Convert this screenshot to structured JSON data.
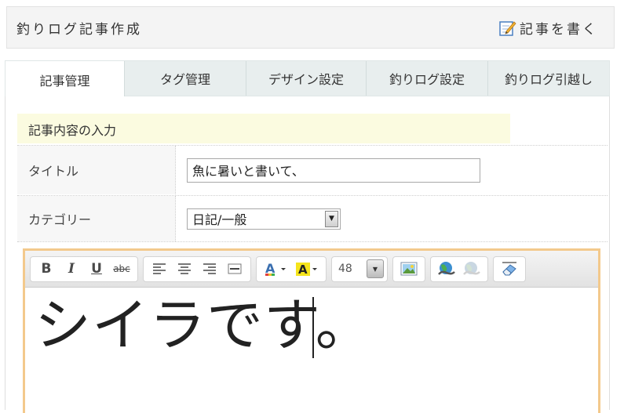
{
  "header": {
    "title": "釣りログ記事作成",
    "write_link": "記事を書く",
    "write_icon": "pencil-note-icon"
  },
  "tabs": [
    {
      "label": "記事管理",
      "active": true
    },
    {
      "label": "タグ管理",
      "active": false
    },
    {
      "label": "デザイン設定",
      "active": false
    },
    {
      "label": "釣りログ設定",
      "active": false
    },
    {
      "label": "釣りログ引越し",
      "active": false
    }
  ],
  "form": {
    "section_label": "記事内容の入力",
    "title_label": "タイトル",
    "title_value": "魚に暑いと書いて、",
    "category_label": "カテゴリー",
    "category_value": "日記/一般"
  },
  "editor": {
    "font_size": "48",
    "content": "シイラです。"
  },
  "colors": {
    "editor_border": "#f3c98c",
    "section_bg": "#fbfbe0",
    "tab_bar_bg": "#e8eeee"
  }
}
